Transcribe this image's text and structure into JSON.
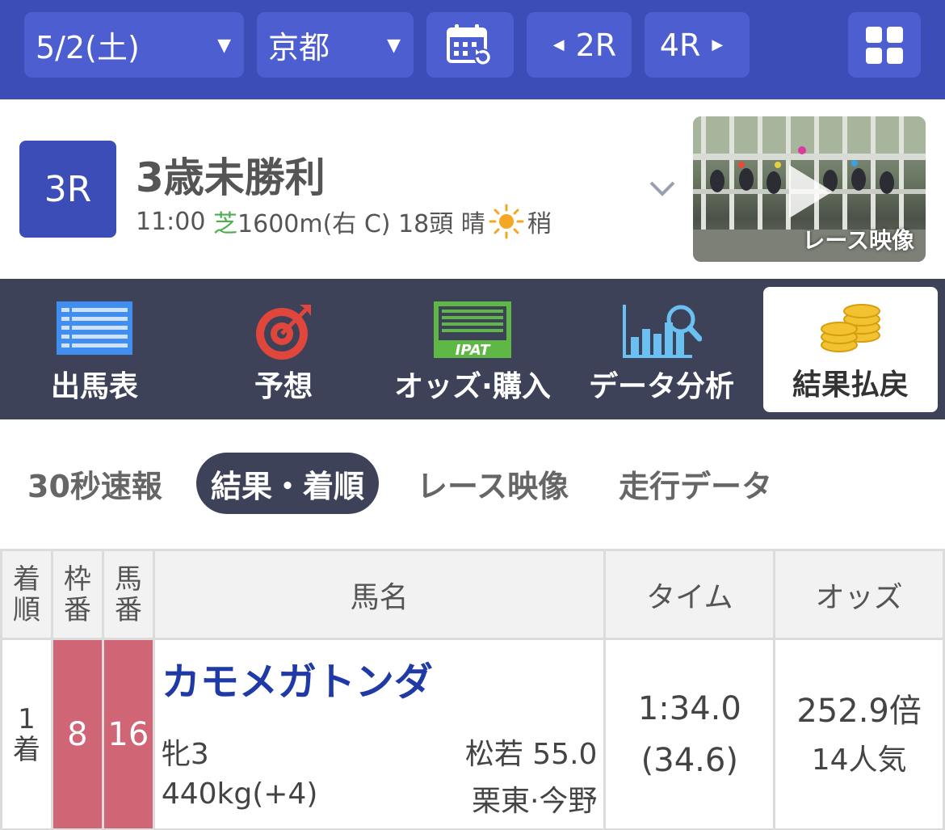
{
  "topbar": {
    "date": "5/2(土)",
    "venue": "京都",
    "prev_race": "2R",
    "next_race": "4R",
    "calendar_icon": "calendar-refresh-icon",
    "menu_icon": "grid-menu-icon",
    "colors": {
      "bar": "#3d4db7",
      "button": "#4d5fd0"
    }
  },
  "race": {
    "number": "3R",
    "name": "3歳未勝利",
    "time": "11:00",
    "surface": "芝",
    "distance": "1600m(右 C)",
    "runners": "18頭",
    "weather": "晴",
    "weather_icon": "sun-icon",
    "going": "稍",
    "video_label": "レース映像"
  },
  "nav": {
    "items": [
      {
        "label": "出馬表",
        "icon": "entry-list-icon"
      },
      {
        "label": "予想",
        "icon": "target-icon"
      },
      {
        "label": "オッズ·購入",
        "icon": "ipat-icon",
        "icon_text": "IPAT"
      },
      {
        "label": "データ分析",
        "icon": "chart-search-icon"
      },
      {
        "label": "結果払戻",
        "icon": "coins-icon",
        "active": true
      }
    ]
  },
  "subtabs": [
    {
      "label": "30秒速報"
    },
    {
      "label": "結果・着順",
      "active": true
    },
    {
      "label": "レース映像"
    },
    {
      "label": "走行データ"
    }
  ],
  "table": {
    "headers": {
      "rank_top": "着",
      "rank_bottom": "順",
      "frame_top": "枠",
      "frame_bottom": "番",
      "number_top": "馬",
      "number_bottom": "番",
      "name": "馬名",
      "time": "タイム",
      "odds": "オッズ"
    },
    "rows": [
      {
        "rank_num": "1",
        "rank_suffix": "着",
        "frame": "8",
        "number": "16",
        "horse": "カモメガトンダ",
        "sex_age": "牝3",
        "weight": "440kg(+4)",
        "jockey": "松若 55.0",
        "trainer": "栗東·今野",
        "time": "1:34.0",
        "last3f": "(34.6)",
        "odds": "252.9倍",
        "popularity": "14人気"
      }
    ]
  }
}
